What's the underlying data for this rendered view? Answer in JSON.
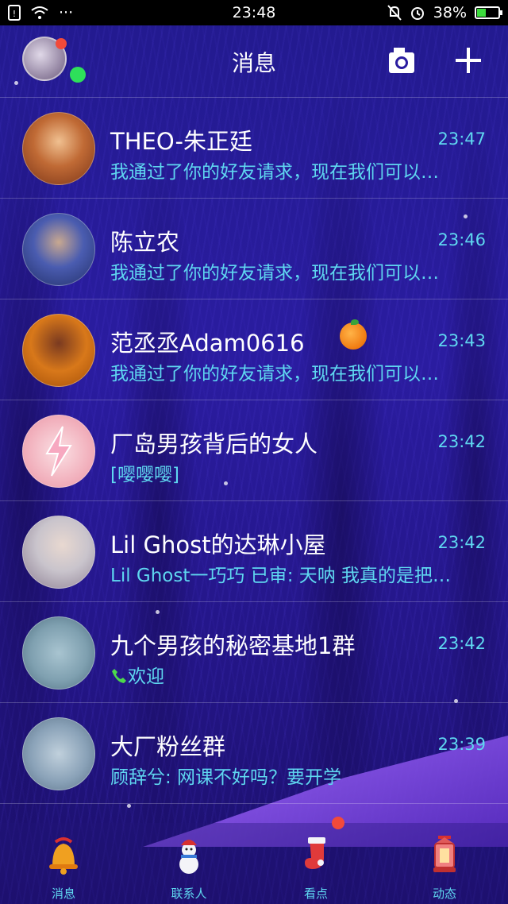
{
  "status_bar": {
    "time": "23:48",
    "battery_percent": "38%",
    "signal_dots": "···"
  },
  "header": {
    "title": "消息",
    "camera_icon": "camera-icon",
    "plus_icon": "plus-icon"
  },
  "chats": [
    {
      "name": "THEO-朱正廷",
      "time": "23:47",
      "preview": "我通过了你的好友请求，现在我们可以…",
      "avatar_color": "#b5502a"
    },
    {
      "name": "陈立农",
      "time": "23:46",
      "preview": "我通过了你的好友请求，现在我们可以…",
      "avatar_color": "#3b4fa0"
    },
    {
      "name": "范丞丞Adam0616",
      "time": "23:43",
      "preview": "我通过了你的好友请求，现在我们可以…",
      "avatar_color": "#d8781a"
    },
    {
      "name": "厂岛男孩背后的女人",
      "time": "23:42",
      "preview": "[嘤嘤嘤]",
      "avatar_color": "#f2b2be"
    },
    {
      "name": "Lil Ghost的达琳小屋",
      "time": "23:42",
      "preview": "Lil Ghost一巧巧 已审: 天呐 我真的是把…",
      "avatar_color": "#c9c4cc"
    },
    {
      "name": "九个男孩的秘密基地1群",
      "time": "23:42",
      "preview": "欢迎",
      "avatar_color": "#7fa0b0"
    },
    {
      "name": "大厂粉丝群",
      "time": "23:39",
      "preview": "顾辞兮: 网课不好吗？要开学",
      "avatar_color": "#8aa2b8"
    }
  ],
  "tabs": [
    {
      "label": "消息",
      "icon": "bell-icon"
    },
    {
      "label": "联系人",
      "icon": "snowman-icon"
    },
    {
      "label": "看点",
      "icon": "stocking-icon"
    },
    {
      "label": "动态",
      "icon": "lantern-icon"
    }
  ],
  "colors": {
    "accent": "#5fd7f0",
    "badge_red": "#f24a3a",
    "online_green": "#2ee05a"
  }
}
